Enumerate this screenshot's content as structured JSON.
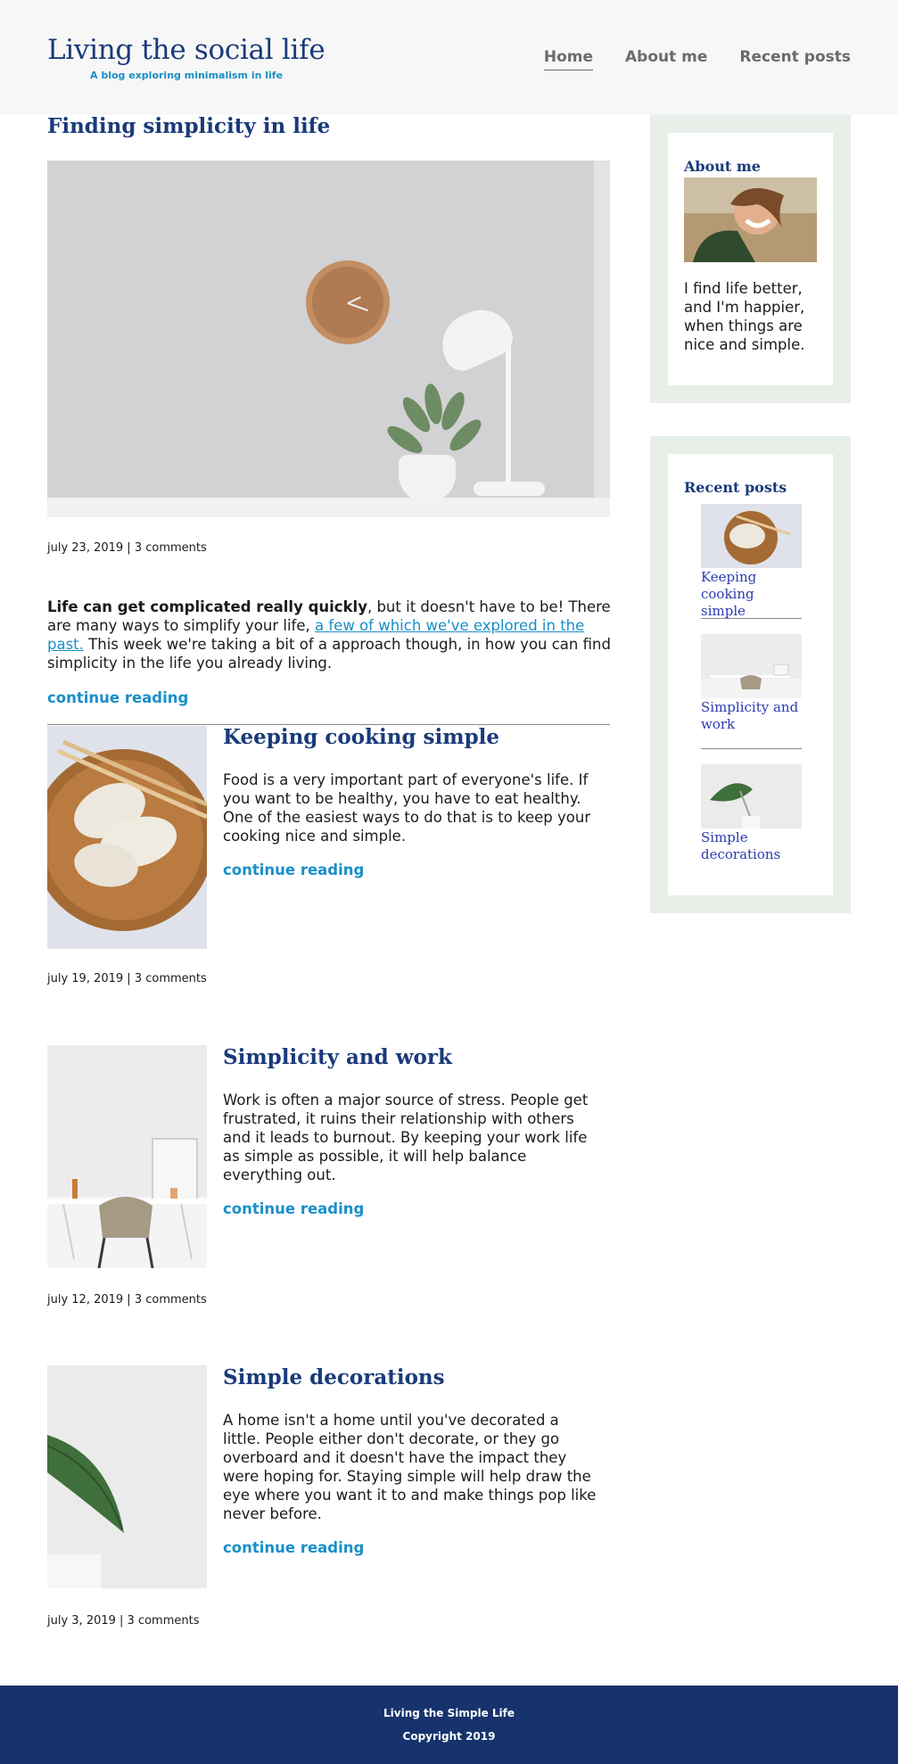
{
  "header": {
    "brand_title": "Living the social life",
    "brand_tagline": "A blog exploring minimalism in life",
    "nav": [
      "Home",
      "About me",
      "Recent posts"
    ]
  },
  "featured": {
    "title": "Finding simplicity in life",
    "meta": "july 23, 2019 | 3 comments",
    "intro_bold": "Life can get complicated really quickly",
    "intro_part1": ", but it doesn't have to be! There are many ways to simplify your life, ",
    "intro_link": "a few of which we've explored in the past.",
    "intro_part2": " This week we're taking a bit of a approach though, in how you can find simplicity in the life you already living.",
    "continue": "continue reading"
  },
  "posts": [
    {
      "title": "Keeping cooking simple",
      "excerpt": "Food is a very important part of everyone's life. If you want to be healthy, you have to eat healthy. One of the easiest ways to do that is to keep your cooking nice and simple.",
      "continue": "continue reading",
      "meta": "july 19, 2019 | 3 comments"
    },
    {
      "title": "Simplicity and work",
      "excerpt": "Work is often a major source of stress. People get frustrated, it ruins their relationship with others and it leads to burnout. By keeping your work life as simple as possible, it will help balance everything out.",
      "continue": "continue reading",
      "meta": "july 12, 2019 | 3 comments"
    },
    {
      "title": "Simple decorations",
      "excerpt": "A home isn't a home until you've decorated a little. People either don't decorate, or they go overboard and it doesn't have the impact they were hoping for. Staying simple will help draw the eye where you want it to and make things pop like never before.",
      "continue": "continue reading",
      "meta": "july 3, 2019 | 3 comments"
    }
  ],
  "sidebar": {
    "about_title": "About me",
    "about_text": "I find life better, and I'm happier, when things are nice and simple.",
    "recent_title": "Recent posts",
    "recent": [
      "Keeping cooking simple",
      "Simplicity and work",
      "Simple decorations"
    ]
  },
  "footer": {
    "line1": "Living the Simple Life",
    "line2": "Copyright 2019"
  }
}
